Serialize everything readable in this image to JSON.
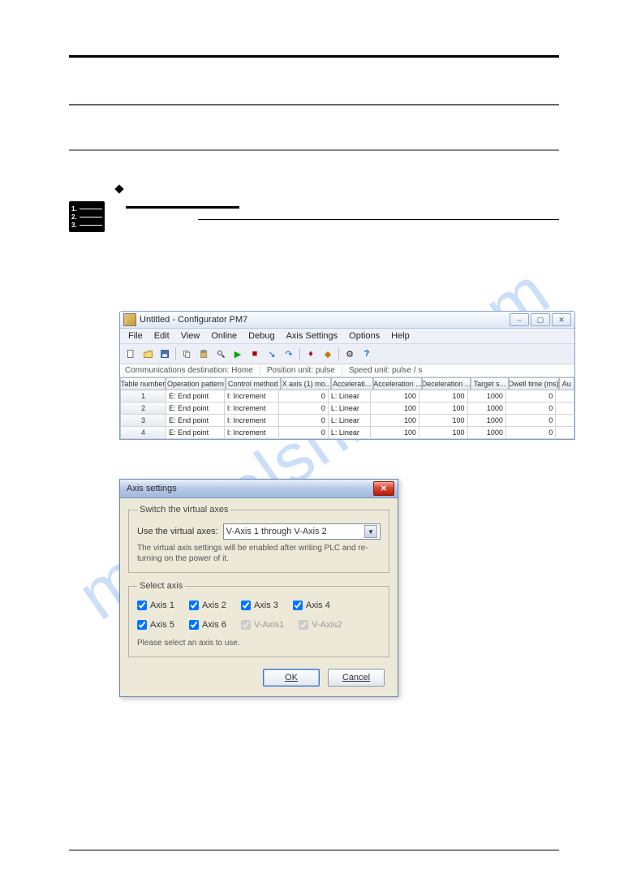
{
  "watermark": "manualshive.com",
  "app": {
    "title": "Untitled - Configurator PM7",
    "menus": [
      "File",
      "Edit",
      "View",
      "Online",
      "Debug",
      "Axis Settings",
      "Options",
      "Help"
    ],
    "window_controls": {
      "min": "_",
      "max": "□",
      "close": "✕"
    },
    "toolbar": [
      {
        "name": "new-icon"
      },
      {
        "name": "open-icon"
      },
      {
        "name": "save-icon"
      },
      {
        "sep": true
      },
      {
        "name": "copy-icon"
      },
      {
        "name": "paste-icon"
      },
      {
        "name": "find-icon"
      },
      {
        "name": "run-icon"
      },
      {
        "name": "stop-icon"
      },
      {
        "name": "step-in-icon"
      },
      {
        "name": "step-over-icon"
      },
      {
        "sep": true
      },
      {
        "name": "tool-a-icon"
      },
      {
        "name": "tool-b-icon"
      },
      {
        "sep": true
      },
      {
        "name": "settings-icon"
      },
      {
        "name": "help-icon"
      }
    ],
    "status": {
      "dest": "Communications destination: Home",
      "pos": "Position unit: pulse",
      "spd": "Speed unit: pulse / s"
    },
    "grid": {
      "columns": [
        "Table number",
        "Operation pattern",
        "Control method",
        "X axis (1) mo..",
        "Accelerati...",
        "Acceleration ...",
        "Deceleration ...",
        "Target s...",
        "Dwell time (ms)",
        "Au"
      ],
      "rows": [
        {
          "n": "1",
          "op": "E: End point",
          "cm": "I: Increment",
          "x": "0",
          "acc": "L: Linear",
          "acct": "100",
          "dec": "100",
          "tgt": "1000",
          "dw": "0"
        },
        {
          "n": "2",
          "op": "E: End point",
          "cm": "I: Increment",
          "x": "0",
          "acc": "L: Linear",
          "acct": "100",
          "dec": "100",
          "tgt": "1000",
          "dw": "0"
        },
        {
          "n": "3",
          "op": "E: End point",
          "cm": "I: Increment",
          "x": "0",
          "acc": "L: Linear",
          "acct": "100",
          "dec": "100",
          "tgt": "1000",
          "dw": "0"
        },
        {
          "n": "4",
          "op": "E: End point",
          "cm": "I: Increment",
          "x": "0",
          "acc": "L: Linear",
          "acct": "100",
          "dec": "100",
          "tgt": "1000",
          "dw": "0"
        }
      ]
    }
  },
  "dialog": {
    "title": "Axis settings",
    "switch_group": "Switch the virtual axes",
    "use_label": "Use the virtual axes:",
    "dropdown_value": "V-Axis 1 through V-Axis 2",
    "hint": "The virtual axis settings will be enabled after writing PLC and re-turning on the power of it.",
    "select_group": "Select axis",
    "axes": [
      {
        "label": "Axis 1",
        "checked": true,
        "enabled": true
      },
      {
        "label": "Axis 2",
        "checked": true,
        "enabled": true
      },
      {
        "label": "Axis 3",
        "checked": true,
        "enabled": true
      },
      {
        "label": "Axis 4",
        "checked": true,
        "enabled": true
      },
      {
        "label": "Axis 5",
        "checked": true,
        "enabled": true
      },
      {
        "label": "Axis 6",
        "checked": true,
        "enabled": true
      },
      {
        "label": "V-Axis1",
        "checked": true,
        "enabled": false
      },
      {
        "label": "V-Axis2",
        "checked": true,
        "enabled": false
      }
    ],
    "select_hint": "Please select an axis to use.",
    "ok": "OK",
    "cancel": "Cancel"
  }
}
